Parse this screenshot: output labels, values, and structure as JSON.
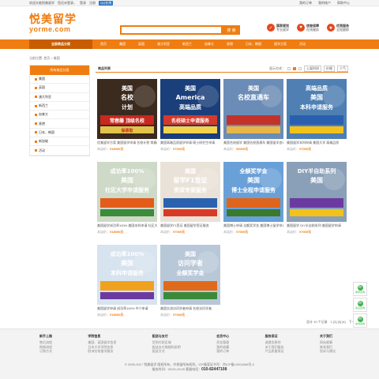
{
  "topbar": {
    "welcome": "欢迎光临悦美留学",
    "login_hint": "您还未登录，",
    "login": "登录",
    "register": "注册",
    "qq": "QQ在线",
    "links": [
      "我的订单",
      "我的帐户",
      "帮助中心"
    ]
  },
  "logo": {
    "cn": "悦美留学",
    "en": "yorme.com"
  },
  "search": {
    "placeholder": "",
    "button": "搜 索"
  },
  "badges": [
    {
      "title": "国家规划",
      "sub": "专业留学",
      "color": "#e2481f",
      "icon": "✓"
    },
    {
      "title": "信誉保障",
      "sub": "在线服务",
      "color": "#e2481f",
      "icon": "♥"
    },
    {
      "title": "优质服务",
      "sub": "全程跟踪",
      "color": "#e2481f",
      "icon": "★"
    }
  ],
  "nav": {
    "all": "全部商品分类",
    "items": [
      "首页",
      "美国",
      "英国",
      "澳大利亚",
      "新西兰",
      "加拿大",
      "香港",
      "日本、韩国",
      "留学方案",
      "活动"
    ]
  },
  "breadcrumb": "当前位置: 首页 > 美国",
  "sidebar": {
    "title": "所有商品分类",
    "items": [
      "美国",
      "英国",
      "澳大利亚",
      "新西兰",
      "加拿大",
      "香港",
      "日本、韩国",
      "新加坡",
      "活动"
    ]
  },
  "main": {
    "title": "商品列表",
    "display_label": "显示方式：",
    "sort": [
      "上架时间",
      "价格",
      "人气"
    ]
  },
  "products": [
    {
      "name": "优美留学方案 美国留学申请 名校计划 常春藤",
      "price_label": "本店价：",
      "price": "¥18000元",
      "img": "p1"
    },
    {
      "name": "美国高端品质留学申请 硕士研究生申请",
      "price_label": "本店价：",
      "price": "¥7000元",
      "img": "p2"
    },
    {
      "name": "美国名校留学 美国名校直通车 美国留学咨询",
      "price_label": "本店价：",
      "price": "¥9000元",
      "img": "p3"
    },
    {
      "name": "美国留学本科申请 美国大学 高端品质",
      "price_label": "本店价：",
      "price": "¥7000元",
      "img": "p4"
    },
    {
      "name": "美国留学成功率100% 美国本科申请 社区大学",
      "price_label": "本店价：",
      "price": "¥18000元",
      "img": "p5"
    },
    {
      "name": "美国留学F1签证 美国留学签证服务",
      "price_label": "本店价：",
      "price": "¥7000元",
      "img": "p6"
    },
    {
      "name": "美国博士申请 全额奖学金 美国博士留学申请",
      "price_label": "本店价：",
      "price": "¥7000元",
      "img": "p7"
    },
    {
      "name": "美国留学 DIY半自助系列 美国留学申请",
      "price_label": "本店价：",
      "price": "¥7000元",
      "img": "p8"
    },
    {
      "name": "美国留学申请 成功率100% 中介申请",
      "price_label": "本店价：",
      "price": "¥18000元",
      "img": "p9"
    },
    {
      "name": "美国交流访问学者申请 名校访问学者",
      "price_label": "本店价：",
      "price": "¥7000元",
      "img": "p10"
    }
  ],
  "images": {
    "p1": {
      "line1": "美国",
      "line2": "名校",
      "line3": "计划",
      "line4": "常春藤 顶级名校",
      "line5": "保录取"
    },
    "p2": {
      "line1": "美国",
      "line2": "America",
      "line3": "高端品质",
      "line4": "名校硕士申请服务"
    },
    "p3": {
      "line1": "美国",
      "line2": "名校直通车"
    },
    "p4": {
      "line1": "高端品质",
      "line2": "美国",
      "line3": "本科申请服务"
    },
    "p5": {
      "line1": "成功率100%",
      "line2": "美国",
      "line3": "社区大学申请服务"
    },
    "p6": {
      "line1": "美国",
      "line2": "留学F1签证",
      "line3": "资深专家服务"
    },
    "p7": {
      "line1": "全额奖学金",
      "line2": "美国",
      "line3": "博士全程申请服务"
    },
    "p8": {
      "line1": "DIY半自助系列",
      "line2": "美国"
    },
    "p9": {
      "line1": "成功率100%",
      "line2": "美国",
      "line3": "本科申请服务"
    },
    "p10": {
      "line1": "美国",
      "line2": "访问学者",
      "line3": "全额奖学金"
    }
  },
  "pager": {
    "total": "总计 10 个记录",
    "pages": "1 [2] [3] [4]",
    "next": "下一页"
  },
  "floats": [
    "留学咨询",
    "签证咨询",
    "在线咨询"
  ],
  "footer": {
    "cols": [
      {
        "title": "新手上路",
        "items": [
          "售后流程",
          "购物流程",
          "订购方式"
        ]
      },
      {
        "title": "学院信息",
        "items": [
          "美国、英国留学信息",
          "日本大学学院信息",
          "欧洲名校留学服务"
        ]
      },
      {
        "title": "配送与支付",
        "items": [
          "货到付款区域",
          "配送支付借细则说明",
          "配送方式"
        ]
      },
      {
        "title": "会员中心",
        "items": [
          "资金管理",
          "我的收藏",
          "我的订单"
        ]
      },
      {
        "title": "服务保证",
        "items": [
          "退换货原则",
          "关于我们服务",
          "产品质量保证"
        ]
      },
      {
        "title": "关于我们",
        "items": [
          "网站故事",
          "联系我们",
          "投诉与建议"
        ]
      }
    ],
    "copyright": "© 2005-2017 悦美留学 版权所有，并保留所有权利。ICP备案证书号：京ICP备12004268号-2",
    "hours": "服务时间：09:00-23:00",
    "phone_label": "客服电话：",
    "phone": "010-82447108"
  }
}
